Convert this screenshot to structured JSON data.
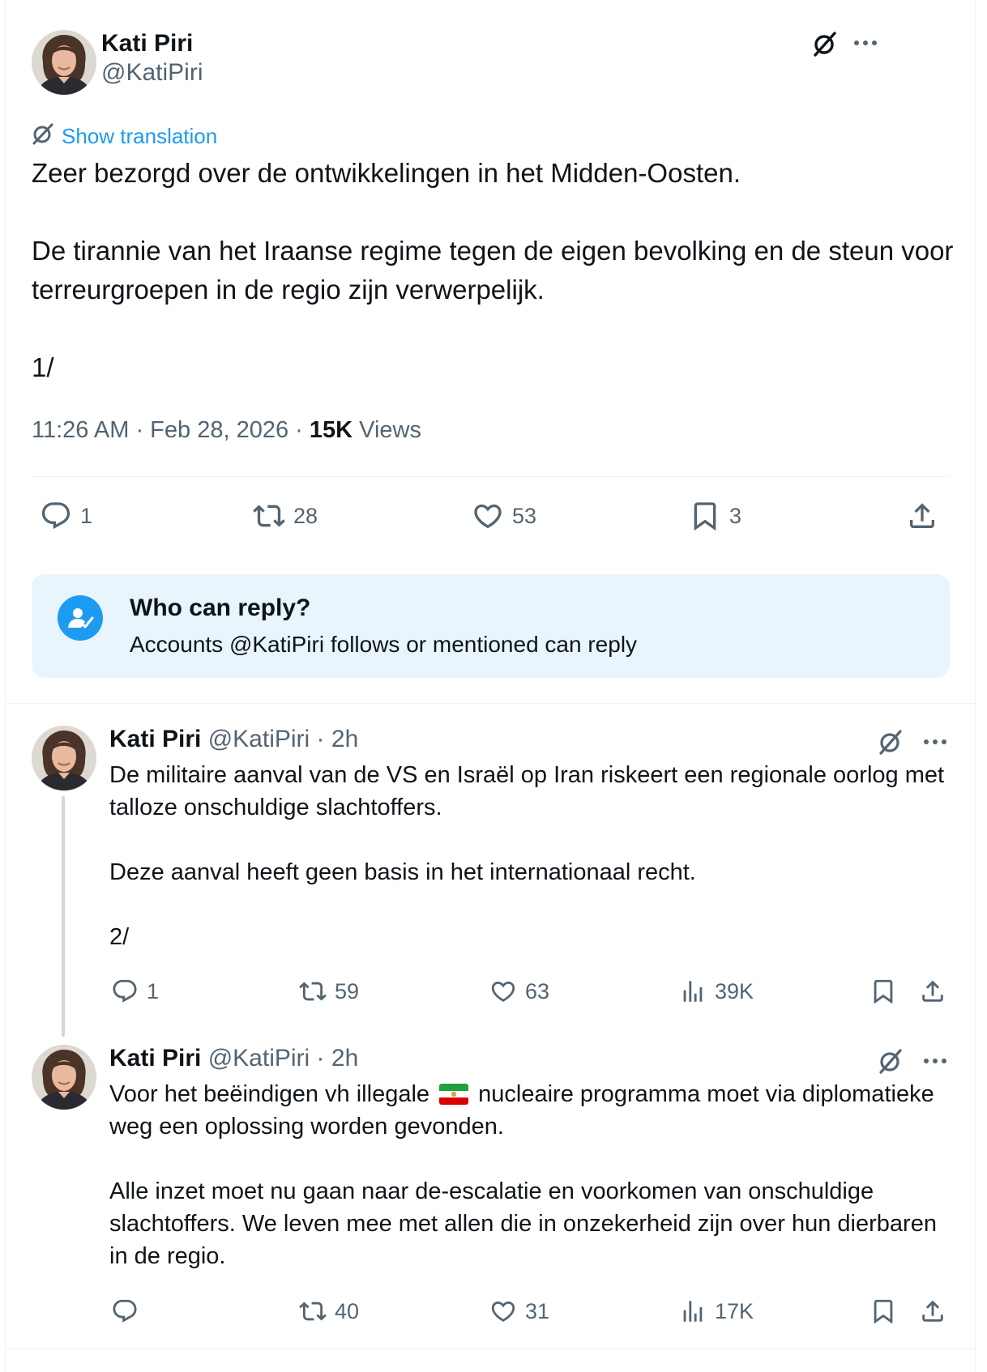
{
  "main_tweet": {
    "author_name": "Kati Piri",
    "author_handle": "@KatiPiri",
    "show_translation": "Show translation",
    "paragraphs": [
      "Zeer bezorgd over de ontwikkelingen in het Midden-Oosten.",
      "De tirannie van het Iraanse regime tegen de eigen bevolking en de steun voor terreurgroepen in de regio zijn verwerpelijk.",
      "1/"
    ],
    "time": "11:26 AM",
    "date": "Feb 28, 2026",
    "views_count": "15K",
    "views_label": "Views",
    "stats": {
      "replies": "1",
      "reposts": "28",
      "likes": "53",
      "bookmarks": "3"
    }
  },
  "who_can_reply": {
    "title": "Who can reply?",
    "subtitle": "Accounts @KatiPiri follows or mentioned can reply"
  },
  "thread": [
    {
      "author_name": "Kati Piri",
      "author_handle": "@KatiPiri",
      "dot": "·",
      "time": "2h",
      "paragraphs": [
        "De militaire aanval van de VS en Israël op Iran riskeert een regionale oorlog met talloze onschuldige slachtoffers.",
        "Deze aanval heeft geen basis in het internationaal recht.",
        "2/"
      ],
      "stats": {
        "replies": "1",
        "reposts": "59",
        "likes": "63",
        "views": "39K"
      }
    },
    {
      "author_name": "Kati Piri",
      "author_handle": "@KatiPiri",
      "dot": "·",
      "time": "2h",
      "text_before_flag": "Voor het beëindigen vh illegale",
      "text_after_flag": "nucleaire programma moet via diplomatieke weg een oplossing worden gevonden.",
      "paragraph_2": "Alle inzet moet nu gaan naar de-escalatie en voorkomen van onschuldige slachtoffers. We leven mee met allen die in onzekerheid zijn over hun dierbaren in de regio.",
      "stats": {
        "replies": "",
        "reposts": "40",
        "likes": "31",
        "views": "17K"
      }
    }
  ],
  "icons": {
    "grok": "grok-icon",
    "more": "more-icon",
    "reply": "reply-icon",
    "repost": "repost-icon",
    "like": "like-icon",
    "bookmark": "bookmark-icon",
    "share": "share-icon",
    "views": "views-icon",
    "people": "people-check-icon",
    "translate": "translate-icon",
    "flag": "iran-flag-icon"
  },
  "colors": {
    "accent": "#1d9bf0",
    "text": "#0f1419",
    "muted": "#536471",
    "reply_box_bg": "#e8f5fd",
    "divider": "#eff3f4"
  }
}
